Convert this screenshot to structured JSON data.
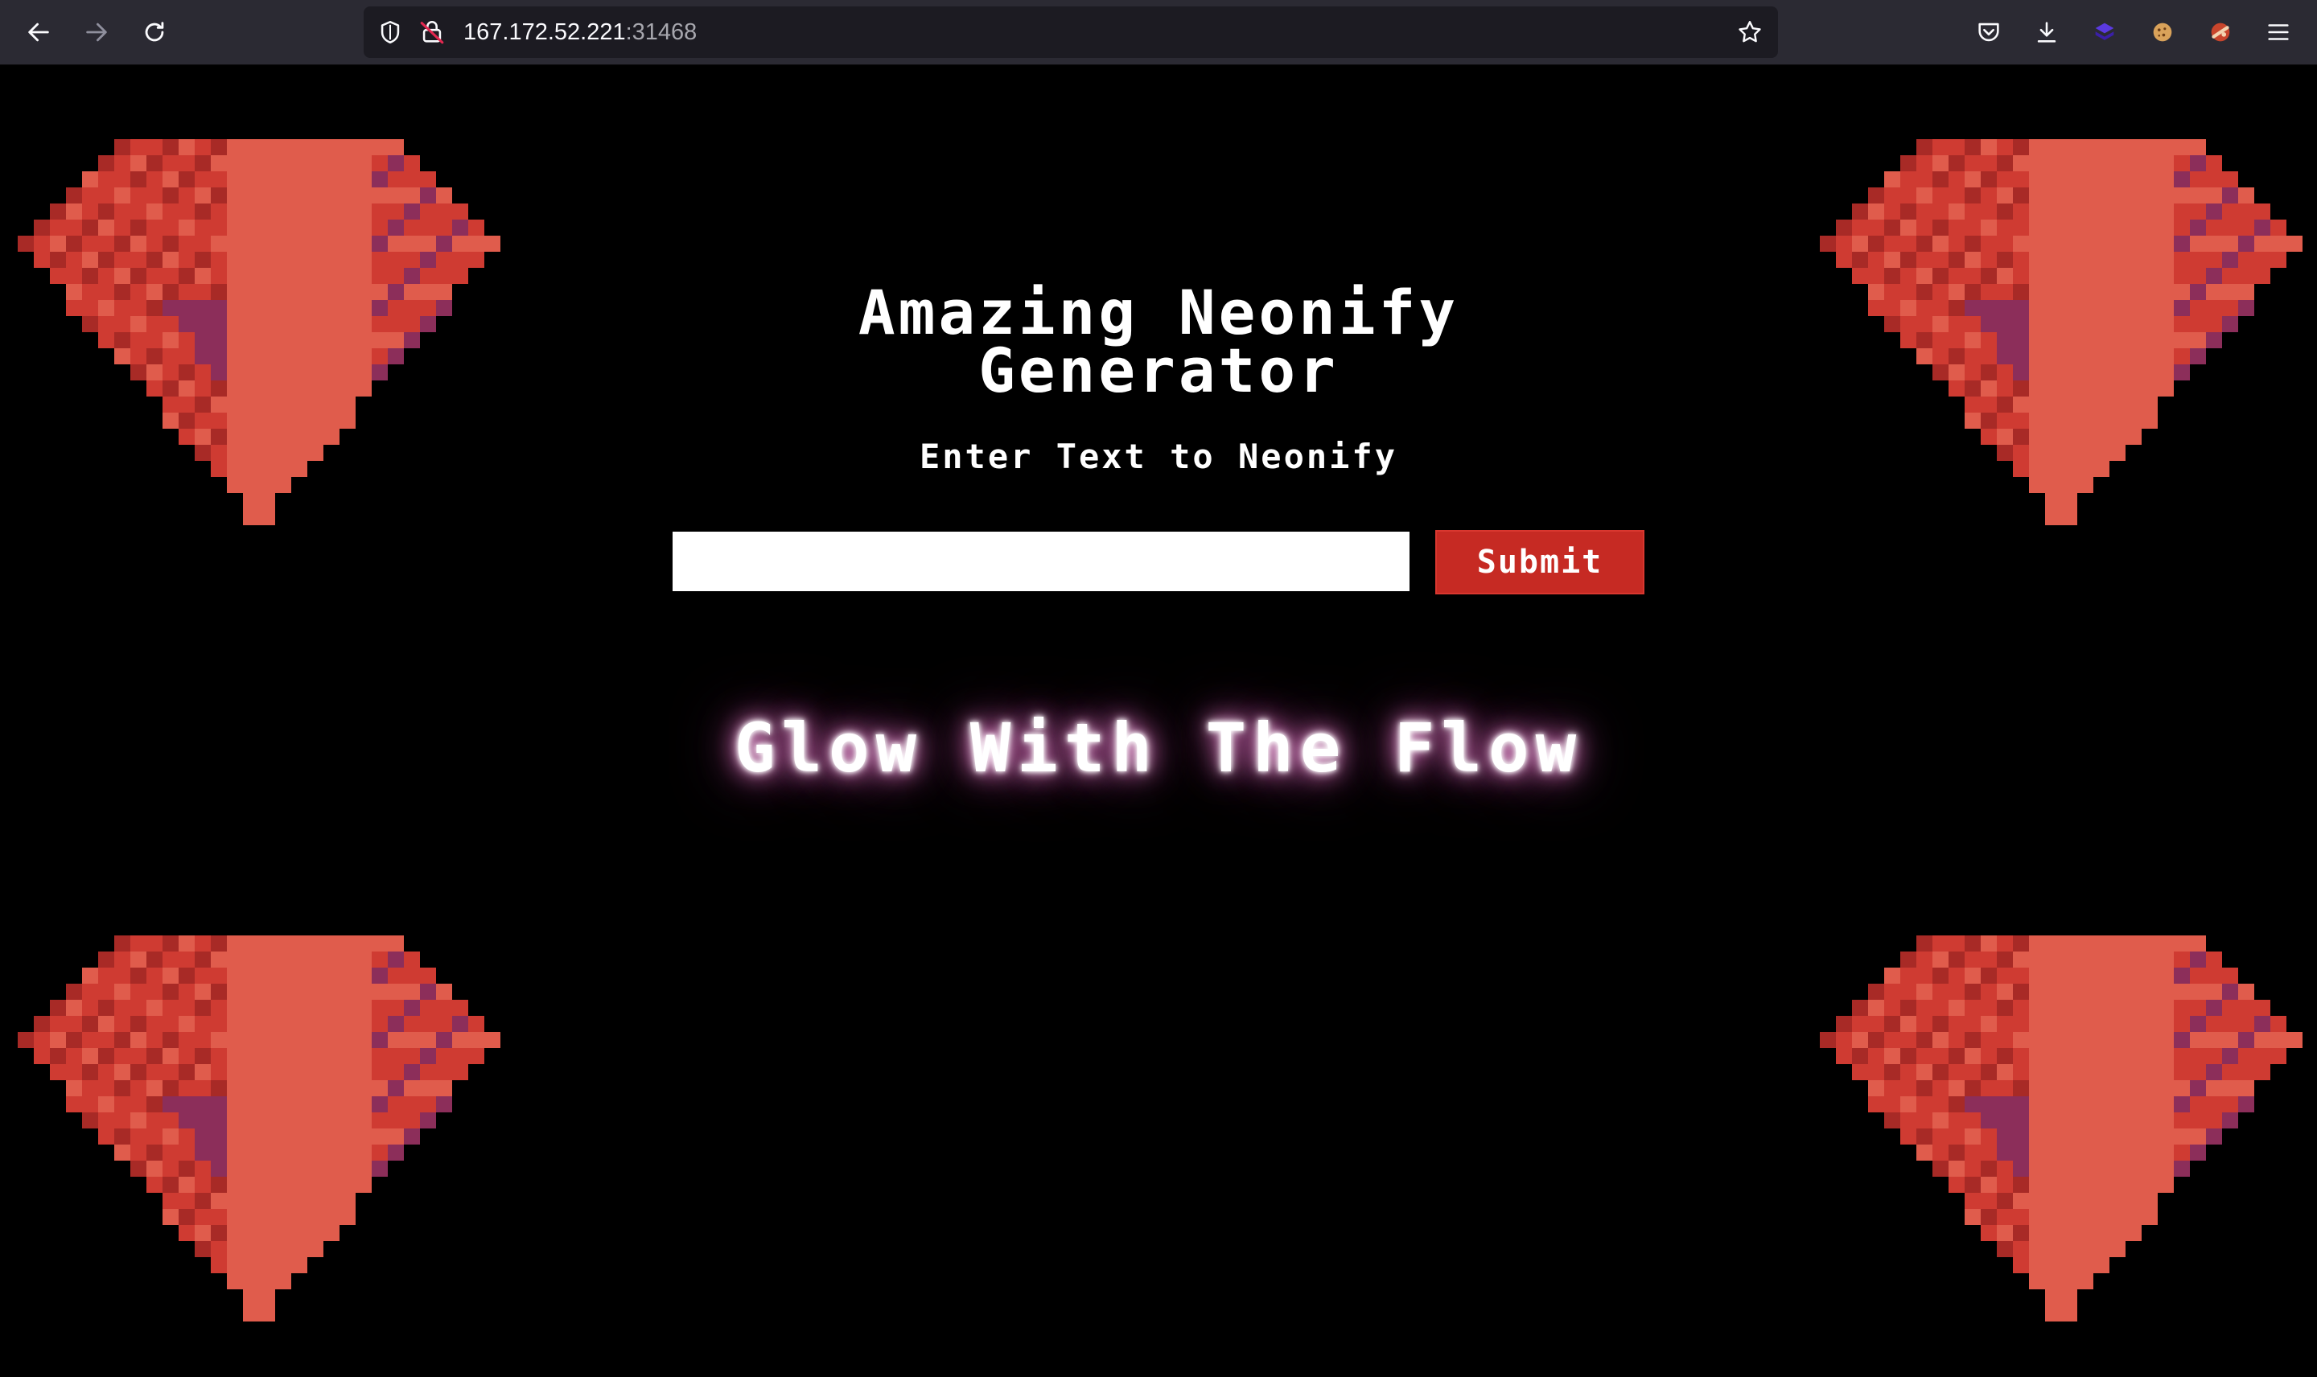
{
  "browser": {
    "url_host": "167.172.52.221",
    "url_port": ":31468",
    "icons": {
      "back": "back-arrow-icon",
      "forward": "forward-arrow-icon",
      "reload": "reload-icon",
      "shield": "tracking-protection-shield-icon",
      "lock": "insecure-lock-icon",
      "bookmark": "bookmark-star-icon",
      "pocket": "pocket-icon",
      "downloads": "download-icon",
      "extension1": "extension-cube-icon",
      "extension2": "cookie-icon",
      "extension3": "extension-avatar-icon",
      "menu": "hamburger-menu-icon"
    }
  },
  "page": {
    "title": "Amazing Neonify Generator",
    "subtitle": "Enter Text to Neonify",
    "input": {
      "value": "",
      "placeholder": ""
    },
    "submit_label": "Submit",
    "neon_output": "Glow With The Flow"
  },
  "colors": {
    "background": "#000000",
    "submit": "#c62a23",
    "gem_light": "#e05c4c",
    "gem_mid": "#cf3b32",
    "gem_dark": "#a82a26",
    "gem_purple": "#8c2e5a",
    "neon_glow": "#ff8ae0"
  }
}
